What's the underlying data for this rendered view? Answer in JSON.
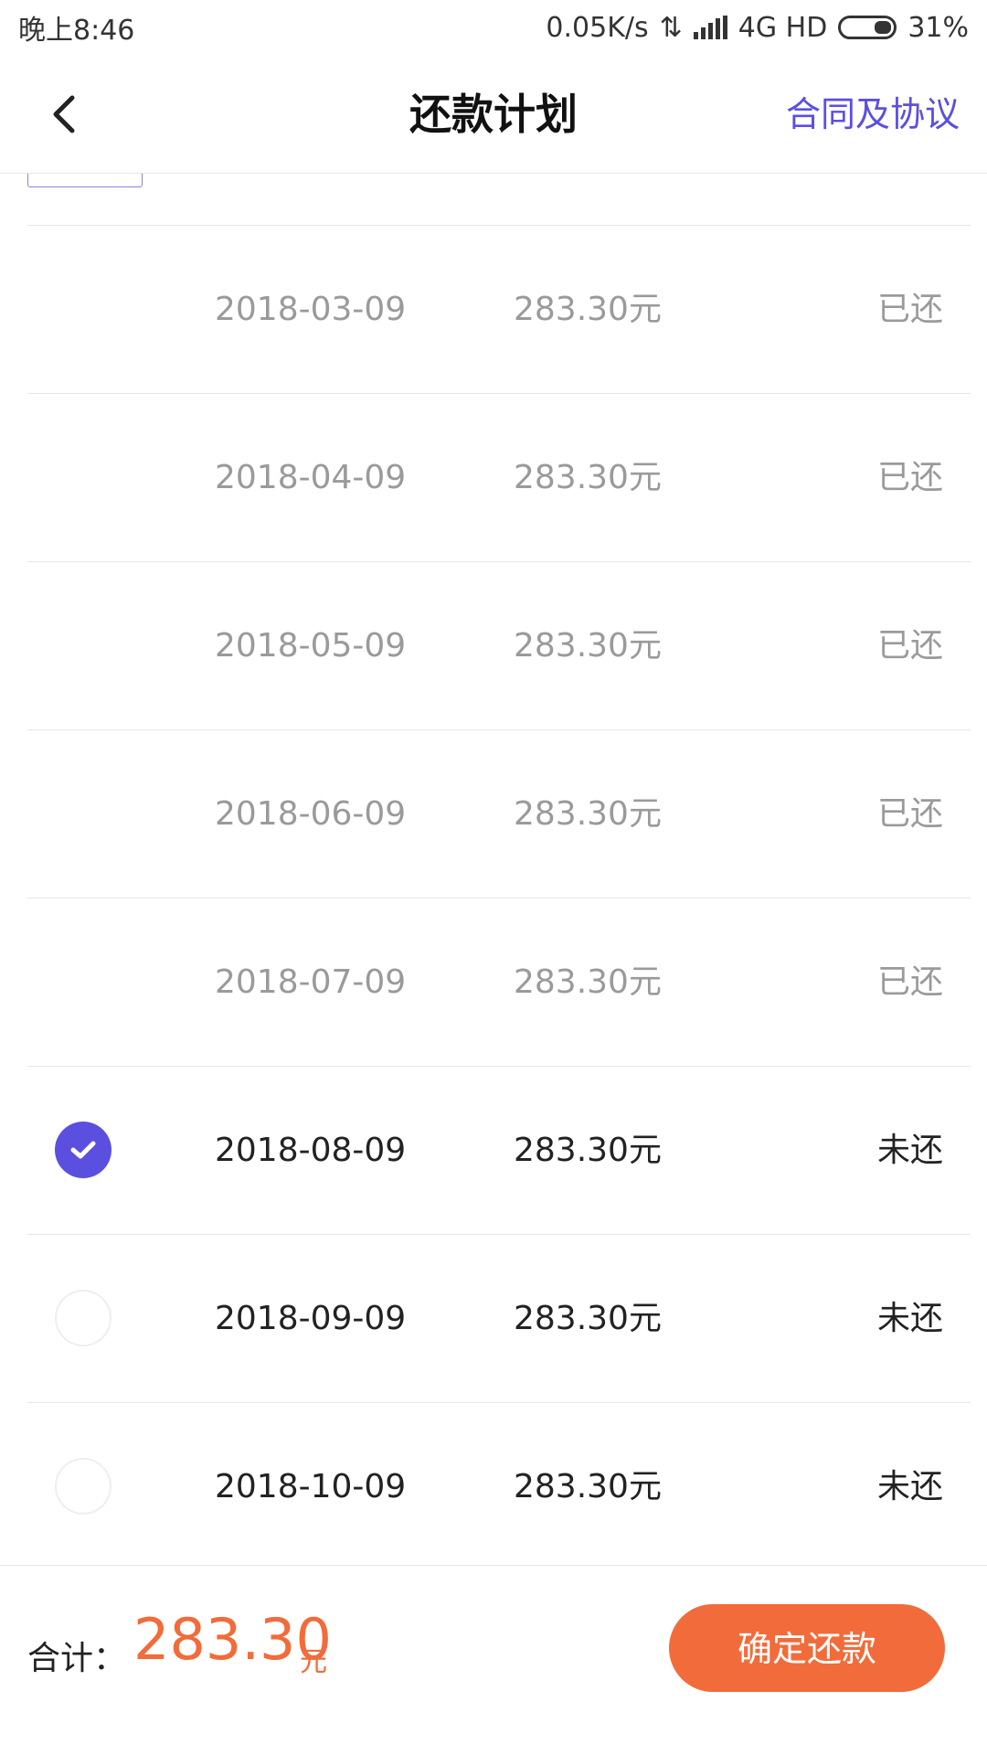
{
  "status_bar": {
    "time": "晚上8:46",
    "net_speed": "0.05K/s",
    "network": "4G HD",
    "battery": "31%"
  },
  "header": {
    "title": "还款计划",
    "contract_link": "合同及协议",
    "back_icon": "chevron-left-icon"
  },
  "plan": {
    "rows": [
      {
        "date": "2018-03-09",
        "amount": "283.30元",
        "status": "已还",
        "state": "paid",
        "selected": false
      },
      {
        "date": "2018-04-09",
        "amount": "283.30元",
        "status": "已还",
        "state": "paid",
        "selected": false
      },
      {
        "date": "2018-05-09",
        "amount": "283.30元",
        "status": "已还",
        "state": "paid",
        "selected": false
      },
      {
        "date": "2018-06-09",
        "amount": "283.30元",
        "status": "已还",
        "state": "paid",
        "selected": false
      },
      {
        "date": "2018-07-09",
        "amount": "283.30元",
        "status": "已还",
        "state": "paid",
        "selected": false
      },
      {
        "date": "2018-08-09",
        "amount": "283.30元",
        "status": "未还",
        "state": "unpaid",
        "selected": true
      },
      {
        "date": "2018-09-09",
        "amount": "283.30元",
        "status": "未还",
        "state": "unpaid",
        "selected": false
      },
      {
        "date": "2018-10-09",
        "amount": "283.30元",
        "status": "未还",
        "state": "unpaid",
        "selected": false
      }
    ]
  },
  "footer": {
    "total_label": "合计：",
    "total_amount": "283.30",
    "total_unit": "元",
    "confirm_label": "确定还款"
  },
  "colors": {
    "accent": "#5b4fe0",
    "primary_button": "#f26b3a",
    "muted_text": "#9a9a9a"
  }
}
